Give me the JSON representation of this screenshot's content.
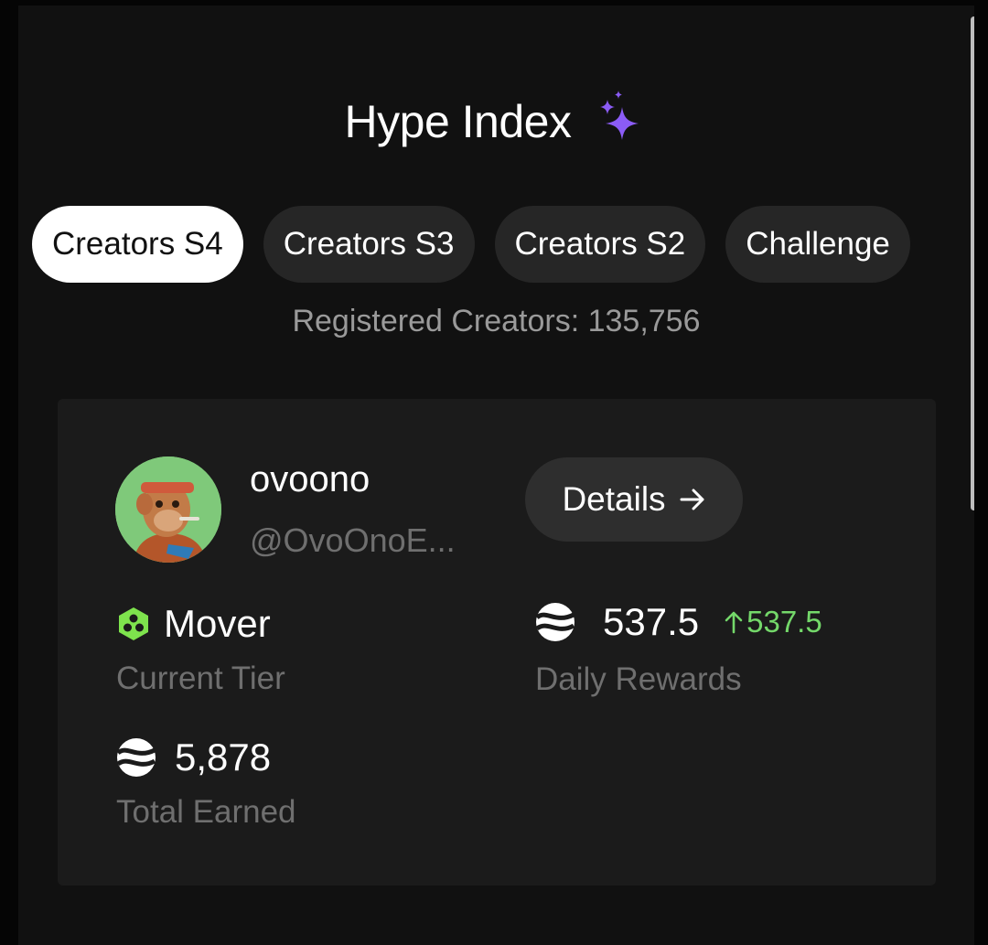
{
  "header": {
    "title": "Hype Index",
    "title_icon": "sparkle-icon",
    "accent_color": "#8b5cf6"
  },
  "tabs": [
    {
      "label": "Creators S4",
      "active": true
    },
    {
      "label": "Creators S3",
      "active": false
    },
    {
      "label": "Creators S2",
      "active": false
    },
    {
      "label": "Challenge",
      "active": false
    }
  ],
  "registered_creators": "Registered Creators: 135,756",
  "profile": {
    "name": "ovoono",
    "handle": "@OvoOnoE...",
    "details_label": "Details",
    "details_icon": "arrow-right-icon"
  },
  "stats": {
    "tier": {
      "value": "Mover",
      "label": "Current Tier",
      "icon": "tier-hexagon-icon",
      "icon_color": "#7ee34d"
    },
    "daily": {
      "value": "537.5",
      "delta": "537.5",
      "delta_icon": "arrow-up-icon",
      "delta_color": "#74d86a",
      "label": "Daily Rewards",
      "icon": "token-icon"
    },
    "total": {
      "value": "5,878",
      "label": "Total Earned",
      "icon": "token-icon"
    }
  }
}
